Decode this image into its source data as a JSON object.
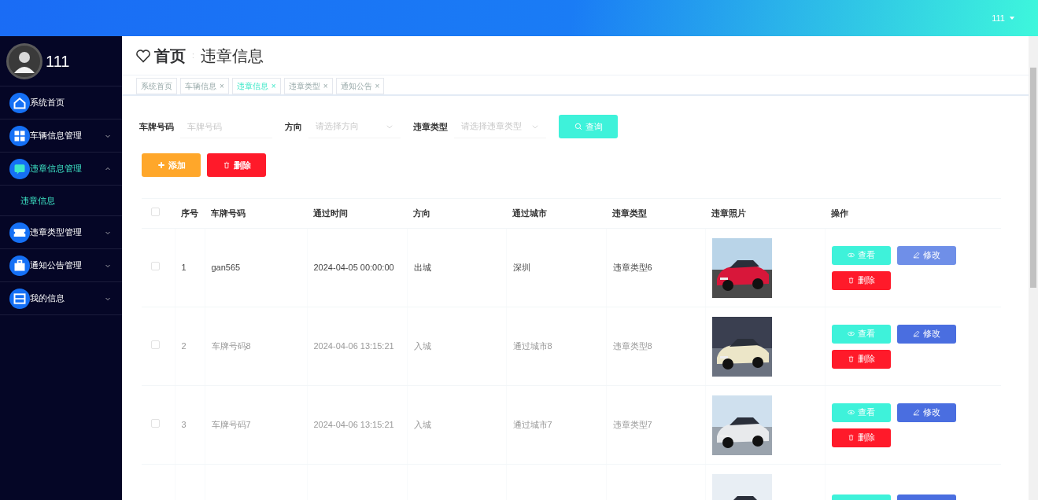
{
  "topbar": {
    "user": "111"
  },
  "sidebar": {
    "user": "111",
    "items": [
      {
        "label": "系统首页",
        "selected": false
      },
      {
        "label": "车辆信息管理",
        "expanded": false,
        "selected": false
      },
      {
        "label": "违章信息管理",
        "expanded": true,
        "selected": true,
        "children": [
          {
            "label": "违章信息",
            "selected": true
          }
        ]
      },
      {
        "label": "违章类型管理",
        "expanded": false,
        "selected": false
      },
      {
        "label": "通知公告管理",
        "expanded": false,
        "selected": false
      },
      {
        "label": "我的信息",
        "expanded": false,
        "selected": false
      }
    ]
  },
  "breadcrumb": {
    "home": "首页",
    "separator": ":",
    "current": "违章信息"
  },
  "tabs": [
    {
      "label": "系统首页",
      "selected": false
    },
    {
      "label": "车辆信息",
      "close": "×",
      "selected": false
    },
    {
      "label": "违章信息",
      "close": "×",
      "selected": true
    },
    {
      "label": "违章类型",
      "close": "×",
      "selected": false
    },
    {
      "label": "通知公告",
      "close": "×",
      "selected": false
    }
  ],
  "filters": [
    {
      "label": "车牌号码",
      "kind": "text",
      "placeholder": "车牌号码"
    },
    {
      "label": "方向",
      "kind": "select",
      "placeholder": "请选择方向"
    },
    {
      "label": "违章类型",
      "kind": "select",
      "placeholder": "请选择违章类型"
    }
  ],
  "search_button": "查询",
  "actions": [
    {
      "label": "添加",
      "kind": "add"
    },
    {
      "label": "删除",
      "kind": "delete"
    }
  ],
  "table": {
    "select_all_checked": false,
    "columns": [
      "序号",
      "车牌号码",
      "通过时间",
      "方向",
      "通过城市",
      "违章类型",
      "违章照片",
      "操作"
    ],
    "rows": [
      {
        "checked": false,
        "cells": [
          "1",
          "gan565",
          "2024-04-05 00:00:00",
          "出城",
          "深圳",
          "违章类型6"
        ],
        "hovered": true,
        "buttons": [
          "查看",
          "修改",
          "删除"
        ]
      },
      {
        "checked": false,
        "cells": [
          "2",
          "车牌号码8",
          "2024-04-06 13:15:21",
          "入城",
          "通过城市8",
          "违章类型8"
        ],
        "hovered": false,
        "buttons": [
          "查看",
          "修改",
          "删除"
        ]
      },
      {
        "checked": false,
        "cells": [
          "3",
          "车牌号码7",
          "2024-04-06 13:15:21",
          "入城",
          "通过城市7",
          "违章类型7"
        ],
        "hovered": false,
        "buttons": [
          "查看",
          "修改",
          "删除"
        ]
      },
      {
        "kind": "partial"
      }
    ]
  }
}
